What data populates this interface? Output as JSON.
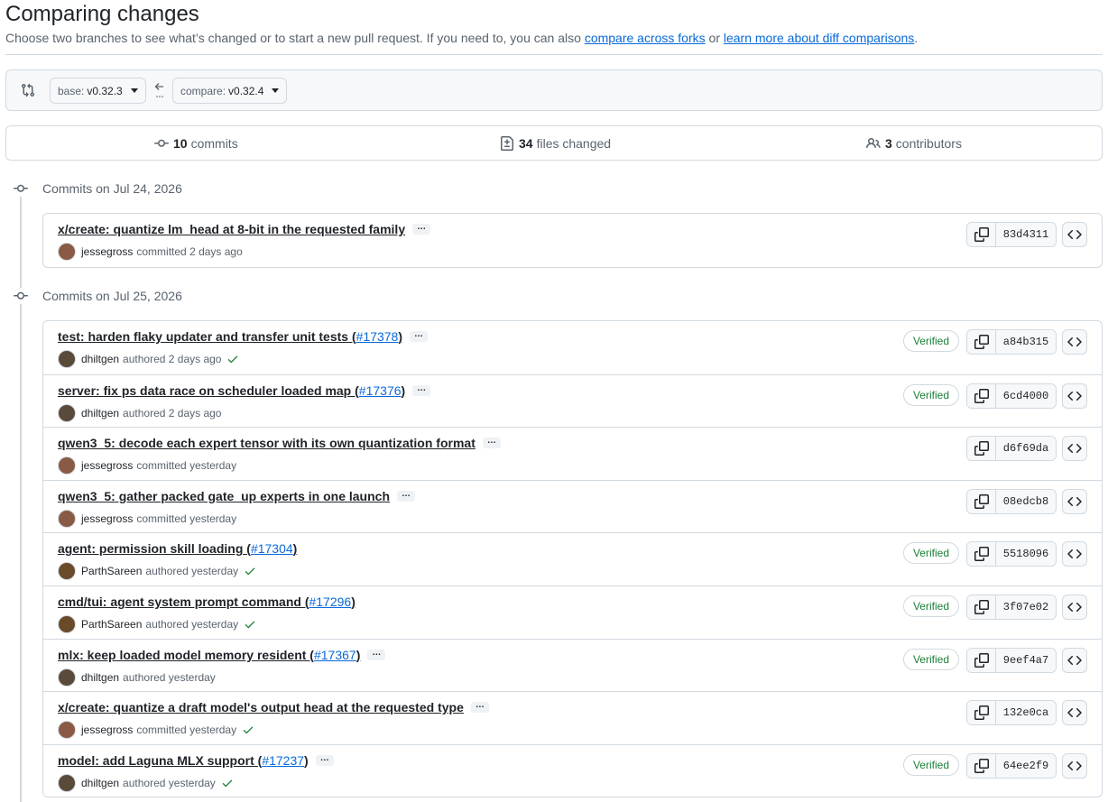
{
  "header": {
    "title": "Comparing changes",
    "subtitle_prefix": "Choose two branches to see what’s changed or to start a new pull request. If you need to, you can also ",
    "link_forks": "compare across forks",
    "subtitle_mid": " or ",
    "link_learn": "learn more about diff comparisons",
    "subtitle_suffix": "."
  },
  "range": {
    "base_prefix": "base:",
    "base_value": "v0.32.3",
    "compare_prefix": "compare:",
    "compare_value": "v0.32.4"
  },
  "summary": {
    "commits_count": "10",
    "commits_label": "commits",
    "files_count": "34",
    "files_label": "files changed",
    "contributors_count": "3",
    "contributors_label": "contributors"
  },
  "groups": [
    {
      "heading": "Commits on Jul 24, 2026",
      "commits": [
        {
          "title": "x/create: quantize lm_head at 8-bit in the requested family",
          "pr": "",
          "author": "jessegross",
          "action": "committed",
          "when": "2 days ago",
          "verified": "",
          "check": false,
          "sha": "83d4311",
          "avatar_color": "#8a5a44",
          "has_dots": true
        }
      ]
    },
    {
      "heading": "Commits on Jul 25, 2026",
      "commits": [
        {
          "title": "test: harden flaky updater and transfer unit tests (",
          "pr": "#17378",
          "author": "dhiltgen",
          "action": "authored",
          "when": "2 days ago",
          "verified": "Verified",
          "check": true,
          "sha": "a84b315",
          "avatar_color": "#5a4a3a",
          "has_dots": true
        },
        {
          "title": "server: fix ps data race on scheduler loaded map (",
          "pr": "#17376",
          "author": "dhiltgen",
          "action": "authored",
          "when": "2 days ago",
          "verified": "Verified",
          "check": false,
          "sha": "6cd4000",
          "avatar_color": "#5a4a3a",
          "has_dots": true
        },
        {
          "title": "qwen3_5: decode each expert tensor with its own quantization format",
          "pr": "",
          "author": "jessegross",
          "action": "committed",
          "when": "yesterday",
          "verified": "",
          "check": false,
          "sha": "d6f69da",
          "avatar_color": "#8a5a44",
          "has_dots": true
        },
        {
          "title": "qwen3_5: gather packed gate_up experts in one launch",
          "pr": "",
          "author": "jessegross",
          "action": "committed",
          "when": "yesterday",
          "verified": "",
          "check": false,
          "sha": "08edcb8",
          "avatar_color": "#8a5a44",
          "has_dots": true
        },
        {
          "title": "agent: permission skill loading (",
          "pr": "#17304",
          "author": "ParthSareen",
          "action": "authored",
          "when": "yesterday",
          "verified": "Verified",
          "check": true,
          "sha": "5518096",
          "avatar_color": "#6b4a2a",
          "has_dots": false
        },
        {
          "title": "cmd/tui: agent system prompt command (",
          "pr": "#17296",
          "author": "ParthSareen",
          "action": "authored",
          "when": "yesterday",
          "verified": "Verified",
          "check": true,
          "sha": "3f07e02",
          "avatar_color": "#6b4a2a",
          "has_dots": false
        },
        {
          "title": "mlx: keep loaded model memory resident (",
          "pr": "#17367",
          "author": "dhiltgen",
          "action": "authored",
          "when": "yesterday",
          "verified": "Verified",
          "check": false,
          "sha": "9eef4a7",
          "avatar_color": "#5a4a3a",
          "has_dots": true
        },
        {
          "title": "x/create: quantize a draft model's output head at the requested type",
          "pr": "",
          "author": "jessegross",
          "action": "committed",
          "when": "yesterday",
          "verified": "",
          "check": true,
          "sha": "132e0ca",
          "avatar_color": "#8a5a44",
          "has_dots": true
        },
        {
          "title": "model: add Laguna MLX support (",
          "pr": "#17237",
          "author": "dhiltgen",
          "action": "authored",
          "when": "yesterday",
          "verified": "Verified",
          "check": true,
          "sha": "64ee2f9",
          "avatar_color": "#5a4a3a",
          "has_dots": true
        }
      ]
    }
  ],
  "colors": {
    "link": "#0969da",
    "verified": "#1a7f37",
    "border": "#d1d9e0",
    "muted": "#59636e"
  },
  "icons": [
    "git-compare-icon",
    "arrow-left-icon",
    "git-commit-icon",
    "file-diff-icon",
    "people-icon",
    "copy-icon",
    "code-icon",
    "check-icon"
  ]
}
